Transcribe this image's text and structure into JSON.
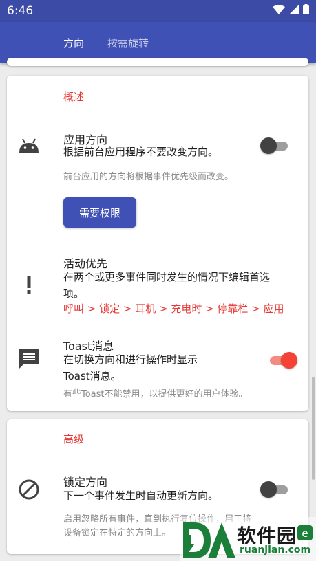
{
  "status_bar": {
    "time": "6:46"
  },
  "tabs": [
    {
      "label": "方向"
    },
    {
      "label": "按需旋转"
    }
  ],
  "card1": {
    "section_title": "概述",
    "app_orientation": {
      "title": "应用方向",
      "subtitle": "根据前台应用程序不要改变方向。",
      "note": "前台应用的方向将根据事件优先级而改变。",
      "button": "需要权限",
      "toggle_on": false
    },
    "priority": {
      "title": "活动优先",
      "subtitle_line1": "在两个或更多事件同时发生的情况下编辑首选",
      "subtitle_line2": "项。",
      "order": "呼叫 > 锁定 > 耳机 > 充电时 > 停靠栏 > 应用"
    },
    "toast": {
      "title": "Toast消息",
      "subtitle_line1": "在切换方向和进行操作时显示",
      "subtitle_line2": "Toast消息。",
      "note": "有些Toast不能禁用，以提供更好的用户体验。",
      "toggle_on": true
    }
  },
  "card2": {
    "section_title": "高级",
    "lock": {
      "title": "锁定方向",
      "subtitle": "下一个事件发生时自动更新方向。",
      "note_line1": "启用忽略所有事件，直到执行复位操作，用于将",
      "note_line2": "设备锁定在特定的方向上。",
      "toggle_on": false
    }
  },
  "watermark": {
    "brand": "软件园",
    "domain": "ruanjian.com"
  },
  "colors": {
    "primary": "#3f51b5",
    "accent": "#f44336"
  },
  "icons": {
    "wifi": "wifi-icon",
    "signal": "signal-icon",
    "battery": "battery-icon"
  }
}
